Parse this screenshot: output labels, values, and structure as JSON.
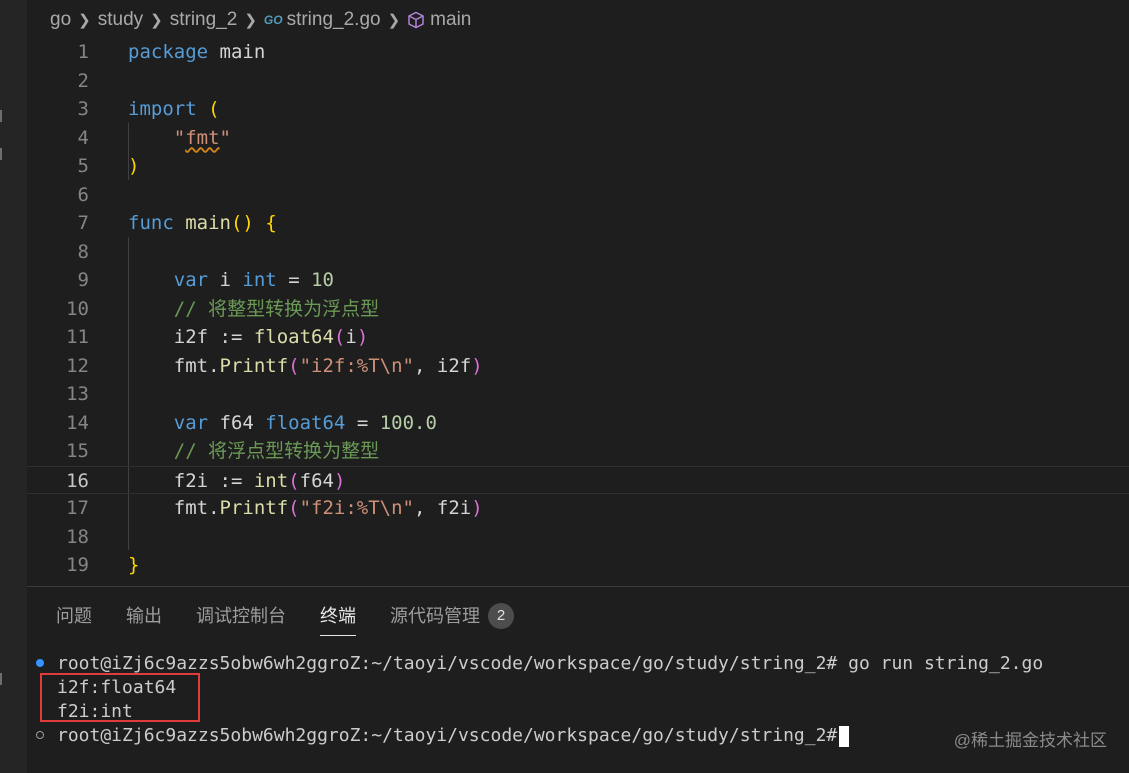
{
  "breadcrumb": {
    "items": [
      "go",
      "study",
      "string_2"
    ],
    "file_icon_text": "GO",
    "file": "string_2.go",
    "symbol": "main"
  },
  "editor": {
    "line_numbers": [
      "1",
      "2",
      "3",
      "4",
      "5",
      "6",
      "7",
      "8",
      "9",
      "10",
      "11",
      "12",
      "13",
      "14",
      "15",
      "16",
      "17",
      "18",
      "19"
    ],
    "current_line": "16",
    "lines": [
      [
        {
          "t": "package",
          "c": "kw"
        },
        {
          "t": " main",
          "c": "plain"
        }
      ],
      [],
      [
        {
          "t": "import",
          "c": "kw"
        },
        {
          "t": " ",
          "c": "plain"
        },
        {
          "t": "(",
          "c": "b1"
        }
      ],
      [
        {
          "t": "    ",
          "c": "plain"
        },
        {
          "t": "\"",
          "c": "str"
        },
        {
          "t": "fmt",
          "c": "str squiggle"
        },
        {
          "t": "\"",
          "c": "str"
        }
      ],
      [
        {
          "t": ")",
          "c": "b1"
        }
      ],
      [],
      [
        {
          "t": "func",
          "c": "kw"
        },
        {
          "t": " main",
          "c": "fn"
        },
        {
          "t": "()",
          "c": "b1"
        },
        {
          "t": " ",
          "c": "plain"
        },
        {
          "t": "{",
          "c": "b1"
        }
      ],
      [],
      [
        {
          "t": "    ",
          "c": "plain"
        },
        {
          "t": "var",
          "c": "kw"
        },
        {
          "t": " i ",
          "c": "plain"
        },
        {
          "t": "int",
          "c": "kw"
        },
        {
          "t": " = ",
          "c": "plain"
        },
        {
          "t": "10",
          "c": "num"
        }
      ],
      [
        {
          "t": "    ",
          "c": "plain"
        },
        {
          "t": "// 将整型转换为浮点型",
          "c": "cmt"
        }
      ],
      [
        {
          "t": "    i2f := ",
          "c": "plain"
        },
        {
          "t": "float64",
          "c": "fn"
        },
        {
          "t": "(",
          "c": "b2"
        },
        {
          "t": "i",
          "c": "plain"
        },
        {
          "t": ")",
          "c": "b2"
        }
      ],
      [
        {
          "t": "    fmt.",
          "c": "plain"
        },
        {
          "t": "Printf",
          "c": "fn"
        },
        {
          "t": "(",
          "c": "b2"
        },
        {
          "t": "\"i2f:%T\\n\"",
          "c": "str"
        },
        {
          "t": ", i2f",
          "c": "plain"
        },
        {
          "t": ")",
          "c": "b2"
        }
      ],
      [],
      [
        {
          "t": "    ",
          "c": "plain"
        },
        {
          "t": "var",
          "c": "kw"
        },
        {
          "t": " f64 ",
          "c": "plain"
        },
        {
          "t": "float64",
          "c": "kw"
        },
        {
          "t": " = ",
          "c": "plain"
        },
        {
          "t": "100.0",
          "c": "num"
        }
      ],
      [
        {
          "t": "    ",
          "c": "plain"
        },
        {
          "t": "// 将浮点型转换为整型",
          "c": "cmt"
        }
      ],
      [
        {
          "t": "    f2i := ",
          "c": "plain"
        },
        {
          "t": "int",
          "c": "fn"
        },
        {
          "t": "(",
          "c": "b2"
        },
        {
          "t": "f64",
          "c": "plain"
        },
        {
          "t": ")",
          "c": "b2"
        }
      ],
      [
        {
          "t": "    fmt.",
          "c": "plain"
        },
        {
          "t": "Printf",
          "c": "fn"
        },
        {
          "t": "(",
          "c": "b2"
        },
        {
          "t": "\"f2i:%T\\n\"",
          "c": "str"
        },
        {
          "t": ", f2i",
          "c": "plain"
        },
        {
          "t": ")",
          "c": "b2"
        }
      ],
      [],
      [
        {
          "t": "}",
          "c": "b1"
        }
      ]
    ]
  },
  "panel": {
    "tabs": [
      "问题",
      "输出",
      "调试控制台",
      "终端",
      "源代码管理"
    ],
    "active_tab": "终端",
    "scm_badge": "2"
  },
  "terminal": {
    "prompt": "root@iZj6c9azzs5obw6wh2ggroZ:~/taoyi/vscode/workspace/go/study/string_2#",
    "command": " go run string_2.go",
    "output": [
      "i2f:float64",
      "f2i:int"
    ]
  },
  "watermark": "@稀土掘金技术社区",
  "colors": {
    "keyword": "#569cd6",
    "function": "#dcdcaa",
    "string": "#ce9178",
    "number": "#b5cea8",
    "comment": "#6a9955",
    "highlight_box": "#e03c3c"
  }
}
